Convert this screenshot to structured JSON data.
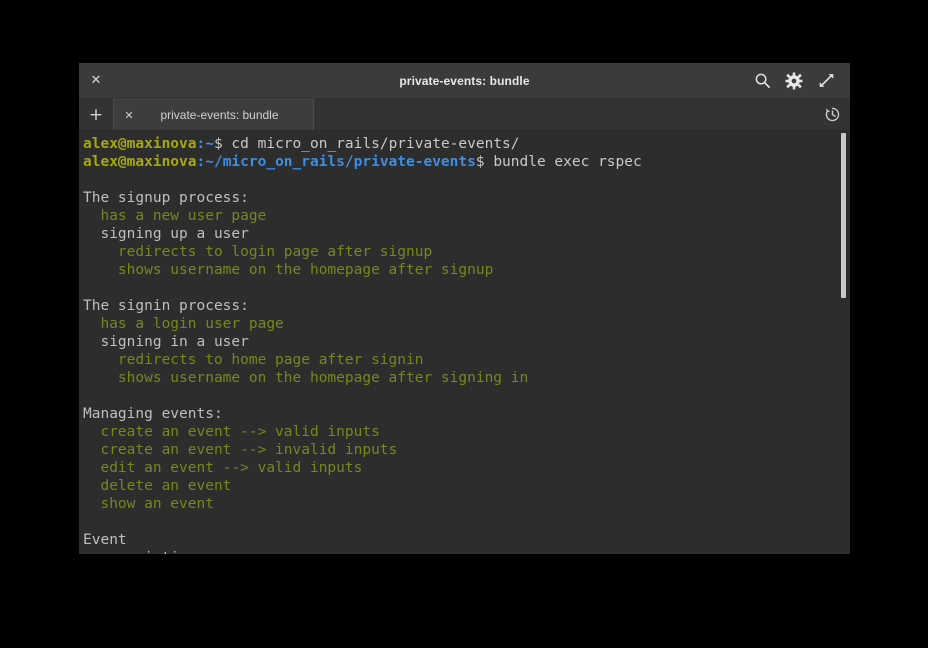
{
  "window": {
    "title": "private-events: bundle",
    "close_label": "✕"
  },
  "titlebar": {
    "icons": [
      {
        "name": "search-icon",
        "label": "Search"
      },
      {
        "name": "gear-icon",
        "label": "Settings"
      },
      {
        "name": "expand-icon",
        "label": "Full screen"
      }
    ]
  },
  "tabbar": {
    "new_tab_label": "+",
    "tab_close_label": "✕",
    "tab_label": "private-events: bundle",
    "history_label": "History"
  },
  "terminal": {
    "colors": {
      "background": "#2d2d2d",
      "foreground": "#c9c9c9",
      "prompt_user": "#a5a812",
      "prompt_path": "#3d8ee0",
      "pass_green": "#77871d"
    },
    "lines": [
      {
        "id": "cmd-cd",
        "segments": [
          {
            "style": "prompt-user",
            "text": "alex@maxinova"
          },
          {
            "style": "prompt-path",
            "text": ":~"
          },
          {
            "style": "default",
            "text": "$ cd micro_on_rails/private-events/"
          }
        ]
      },
      {
        "id": "cmd-rspec",
        "segments": [
          {
            "style": "prompt-user",
            "text": "alex@maxinova"
          },
          {
            "style": "prompt-path",
            "text": ":~/micro_on_rails/private-events"
          },
          {
            "style": "default",
            "text": "$ bundle exec rspec"
          }
        ]
      },
      {
        "id": "blank-1",
        "segments": [
          {
            "style": "default",
            "text": ""
          }
        ]
      },
      {
        "id": "group-signup",
        "segments": [
          {
            "style": "gray",
            "text": "The signup process:"
          }
        ]
      },
      {
        "id": "ex-signup-new-user-page",
        "segments": [
          {
            "style": "green",
            "text": "  has a new user page"
          }
        ]
      },
      {
        "id": "group-signing-up",
        "segments": [
          {
            "style": "gray",
            "text": "  signing up a user"
          }
        ]
      },
      {
        "id": "ex-redirect-login",
        "segments": [
          {
            "style": "green",
            "text": "    redirects to login page after signup"
          }
        ]
      },
      {
        "id": "ex-shows-username-signup",
        "segments": [
          {
            "style": "green",
            "text": "    shows username on the homepage after signup"
          }
        ]
      },
      {
        "id": "blank-2",
        "segments": [
          {
            "style": "default",
            "text": ""
          }
        ]
      },
      {
        "id": "group-signin",
        "segments": [
          {
            "style": "gray",
            "text": "The signin process:"
          }
        ]
      },
      {
        "id": "ex-signin-login-page",
        "segments": [
          {
            "style": "green",
            "text": "  has a login user page"
          }
        ]
      },
      {
        "id": "group-signing-in",
        "segments": [
          {
            "style": "gray",
            "text": "  signing in a user"
          }
        ]
      },
      {
        "id": "ex-redirect-home",
        "segments": [
          {
            "style": "green",
            "text": "    redirects to home page after signin"
          }
        ]
      },
      {
        "id": "ex-shows-username-signin",
        "segments": [
          {
            "style": "green",
            "text": "    shows username on the homepage after signing in"
          }
        ]
      },
      {
        "id": "blank-3",
        "segments": [
          {
            "style": "default",
            "text": ""
          }
        ]
      },
      {
        "id": "group-managing-events",
        "segments": [
          {
            "style": "gray",
            "text": "Managing events:"
          }
        ]
      },
      {
        "id": "ex-create-valid",
        "segments": [
          {
            "style": "green",
            "text": "  create an event --> valid inputs"
          }
        ]
      },
      {
        "id": "ex-create-invalid",
        "segments": [
          {
            "style": "green",
            "text": "  create an event --> invalid inputs"
          }
        ]
      },
      {
        "id": "ex-edit-valid",
        "segments": [
          {
            "style": "green",
            "text": "  edit an event --> valid inputs"
          }
        ]
      },
      {
        "id": "ex-delete-event",
        "segments": [
          {
            "style": "green",
            "text": "  delete an event"
          }
        ]
      },
      {
        "id": "ex-show-event",
        "segments": [
          {
            "style": "green",
            "text": "  show an event"
          }
        ]
      },
      {
        "id": "blank-4",
        "segments": [
          {
            "style": "default",
            "text": ""
          }
        ]
      },
      {
        "id": "group-event",
        "segments": [
          {
            "style": "gray",
            "text": "Event"
          }
        ]
      },
      {
        "id": "group-associations",
        "segments": [
          {
            "style": "gray",
            "text": "  associations"
          }
        ]
      }
    ]
  }
}
